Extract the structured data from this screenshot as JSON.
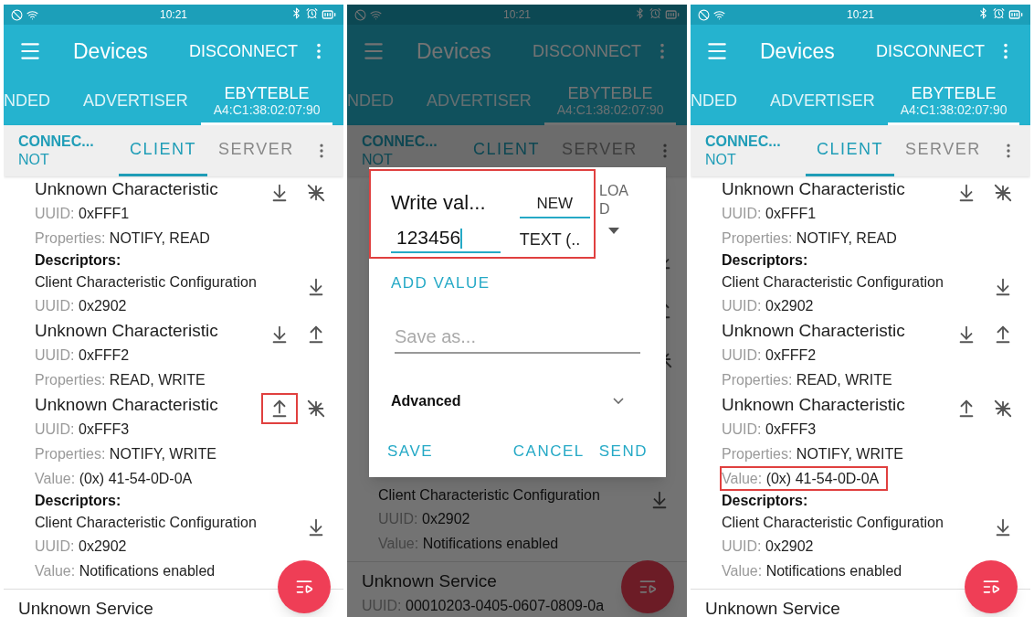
{
  "panels": [
    {
      "status": {
        "time": "10:21"
      },
      "appbar": {
        "title": "Devices",
        "action": "DISCONNECT"
      },
      "tabs": [
        {
          "label": "NDED",
          "selected": false
        },
        {
          "label": "ADVERTISER",
          "selected": false
        },
        {
          "label": "EBYTEBLE",
          "sublabel": "A4:C1:38:02:07:90",
          "selected": true
        }
      ],
      "device": {
        "state": "CONNEC...",
        "bond": "NOT"
      },
      "subtabs": [
        {
          "label": "CLIENT",
          "selected": true
        },
        {
          "label": "SERVER",
          "selected": false
        }
      ],
      "items": [
        {
          "kind": "characteristic",
          "name": "Unknown Characteristic",
          "actions": [
            {
              "kind": "read",
              "highlighted": false
            },
            {
              "kind": "notify",
              "highlighted": false
            }
          ],
          "lines": [
            {
              "label": "UUID:",
              "value": "0xFFF1",
              "highlighted": false
            },
            {
              "label": "Properties:",
              "value": "NOTIFY, READ",
              "highlighted": false
            }
          ]
        },
        {
          "kind": "header",
          "name": "Descriptors:"
        },
        {
          "kind": "descriptor",
          "name": "Client Characteristic Configuration",
          "actions": [
            {
              "kind": "read",
              "highlighted": false
            }
          ],
          "lines": [
            {
              "label": "UUID:",
              "value": "0x2902",
              "highlighted": false
            }
          ]
        },
        {
          "kind": "characteristic",
          "name": "Unknown Characteristic",
          "actions": [
            {
              "kind": "read",
              "highlighted": false
            },
            {
              "kind": "write",
              "highlighted": false
            }
          ],
          "lines": [
            {
              "label": "UUID:",
              "value": "0xFFF2",
              "highlighted": false
            },
            {
              "label": "Properties:",
              "value": "READ, WRITE",
              "highlighted": false
            }
          ]
        },
        {
          "kind": "characteristic",
          "name": "Unknown Characteristic",
          "actions": [
            {
              "kind": "write",
              "highlighted": true
            },
            {
              "kind": "notify",
              "highlighted": false
            }
          ],
          "lines": [
            {
              "label": "UUID:",
              "value": "0xFFF3",
              "highlighted": false
            },
            {
              "label": "Properties:",
              "value": "NOTIFY, WRITE",
              "highlighted": false
            },
            {
              "label": "Value:",
              "value": "(0x) 41-54-0D-0A",
              "highlighted": false
            }
          ]
        },
        {
          "kind": "header",
          "name": "Descriptors:"
        },
        {
          "kind": "descriptor",
          "name": "Client Characteristic Configuration",
          "actions": [
            {
              "kind": "read",
              "highlighted": false
            }
          ],
          "lines": [
            {
              "label": "UUID:",
              "value": "0x2902",
              "highlighted": false
            },
            {
              "label": "Value:",
              "value": "Notifications enabled",
              "highlighted": false
            }
          ]
        },
        {
          "kind": "service",
          "name": "Unknown Service"
        }
      ]
    },
    {
      "status": {
        "time": "10:21"
      },
      "appbar": {
        "title": "Devices",
        "action": "DISCONNECT"
      },
      "tabs": [
        {
          "label": "NDED",
          "selected": false
        },
        {
          "label": "ADVERTISER",
          "selected": false
        },
        {
          "label": "EBYTEBLE",
          "sublabel": "A4:C1:38:02:07:90",
          "selected": true
        }
      ],
      "device": {
        "state": "CONNEC...",
        "bond": "NOT"
      },
      "subtabs": [
        {
          "label": "CLIENT",
          "selected": true
        },
        {
          "label": "SERVER",
          "selected": false
        }
      ],
      "items": [
        {
          "kind": "covered",
          "actions": [
            {
              "kind": "read",
              "highlighted": false
            },
            {
              "kind": "write",
              "highlighted": false
            },
            {
              "kind": "notify",
              "highlighted": false
            }
          ]
        },
        {
          "kind": "descriptor",
          "name": "Client Characteristic Configuration",
          "actions": [
            {
              "kind": "read",
              "highlighted": false
            }
          ],
          "lines": [
            {
              "label": "UUID:",
              "value": "0x2902",
              "highlighted": false
            },
            {
              "label": "Value:",
              "value": "Notifications enabled",
              "highlighted": false
            }
          ]
        },
        {
          "kind": "service",
          "name": "Unknown Service",
          "lines": [
            {
              "label": "UUID:",
              "value": "00010203-0405-0607-0809-0a",
              "highlighted": false
            }
          ]
        }
      ],
      "dialog": {
        "title": "Write val...",
        "highlighted": true,
        "tabs": [
          {
            "label": "NEW",
            "selected": true
          },
          {
            "label": "LOAD",
            "selected": false
          }
        ],
        "value": "123456",
        "format": "TEXT (..",
        "add_value": "ADD VALUE",
        "save_as_placeholder": "Save as...",
        "advanced": "Advanced",
        "buttons": [
          "SAVE",
          "CANCEL",
          "SEND"
        ]
      }
    },
    {
      "status": {
        "time": "10:21"
      },
      "appbar": {
        "title": "Devices",
        "action": "DISCONNECT"
      },
      "tabs": [
        {
          "label": "NDED",
          "selected": false
        },
        {
          "label": "ADVERTISER",
          "selected": false
        },
        {
          "label": "EBYTEBLE",
          "sublabel": "A4:C1:38:02:07:90",
          "selected": true
        }
      ],
      "device": {
        "state": "CONNEC...",
        "bond": "NOT"
      },
      "subtabs": [
        {
          "label": "CLIENT",
          "selected": true
        },
        {
          "label": "SERVER",
          "selected": false
        }
      ],
      "items": [
        {
          "kind": "characteristic",
          "name": "Unknown Characteristic",
          "actions": [
            {
              "kind": "read",
              "highlighted": false
            },
            {
              "kind": "notify",
              "highlighted": false
            }
          ],
          "lines": [
            {
              "label": "UUID:",
              "value": "0xFFF1",
              "highlighted": false
            },
            {
              "label": "Properties:",
              "value": "NOTIFY, READ",
              "highlighted": false
            }
          ]
        },
        {
          "kind": "header",
          "name": "Descriptors:"
        },
        {
          "kind": "descriptor",
          "name": "Client Characteristic Configuration",
          "actions": [
            {
              "kind": "read",
              "highlighted": false
            }
          ],
          "lines": [
            {
              "label": "UUID:",
              "value": "0x2902",
              "highlighted": false
            }
          ]
        },
        {
          "kind": "characteristic",
          "name": "Unknown Characteristic",
          "actions": [
            {
              "kind": "read",
              "highlighted": false
            },
            {
              "kind": "write",
              "highlighted": false
            }
          ],
          "lines": [
            {
              "label": "UUID:",
              "value": "0xFFF2",
              "highlighted": false
            },
            {
              "label": "Properties:",
              "value": "READ, WRITE",
              "highlighted": false
            }
          ]
        },
        {
          "kind": "characteristic",
          "name": "Unknown Characteristic",
          "actions": [
            {
              "kind": "write",
              "highlighted": false
            },
            {
              "kind": "notify",
              "highlighted": false
            }
          ],
          "lines": [
            {
              "label": "UUID:",
              "value": "0xFFF3",
              "highlighted": false
            },
            {
              "label": "Properties:",
              "value": "NOTIFY, WRITE",
              "highlighted": false
            },
            {
              "label": "Value:",
              "value": "(0x) 41-54-0D-0A",
              "highlighted": true
            }
          ]
        },
        {
          "kind": "header",
          "name": "Descriptors:"
        },
        {
          "kind": "descriptor",
          "name": "Client Characteristic Configuration",
          "actions": [
            {
              "kind": "read",
              "highlighted": false
            }
          ],
          "lines": [
            {
              "label": "UUID:",
              "value": "0x2902",
              "highlighted": false
            },
            {
              "label": "Value:",
              "value": "Notifications enabled",
              "highlighted": false
            }
          ]
        },
        {
          "kind": "service",
          "name": "Unknown Service"
        }
      ]
    }
  ]
}
